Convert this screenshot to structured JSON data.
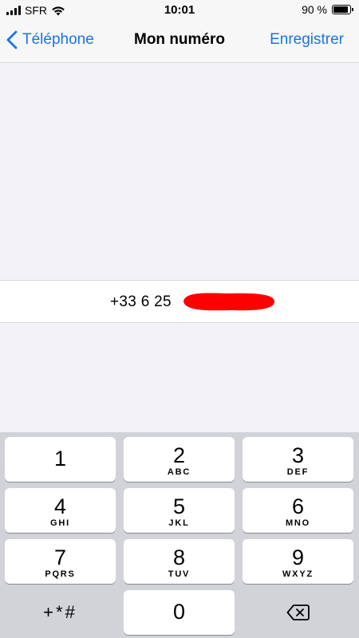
{
  "status_bar": {
    "carrier": "SFR",
    "time": "10:01",
    "battery_percent": "90 %",
    "battery_level": 0.9,
    "icons": [
      "signal-icon",
      "wifi-icon",
      "battery-icon"
    ]
  },
  "nav": {
    "back_label": "Téléphone",
    "title": "Mon numéro",
    "save_label": "Enregistrer",
    "accent_color": "#1a73e8"
  },
  "number_field": {
    "value": "+33 6 25",
    "redaction_color": "#ff0000"
  },
  "keypad": {
    "keys": [
      {
        "digit": "1",
        "letters": ""
      },
      {
        "digit": "2",
        "letters": "ABC"
      },
      {
        "digit": "3",
        "letters": "DEF"
      },
      {
        "digit": "4",
        "letters": "GHI"
      },
      {
        "digit": "5",
        "letters": "JKL"
      },
      {
        "digit": "6",
        "letters": "MNO"
      },
      {
        "digit": "7",
        "letters": "PQRS"
      },
      {
        "digit": "8",
        "letters": "TUV"
      },
      {
        "digit": "9",
        "letters": "WXYZ"
      },
      {
        "digit": "0",
        "letters": ""
      }
    ],
    "symbols_label": "+*#",
    "delete_icon": "backspace-icon"
  }
}
